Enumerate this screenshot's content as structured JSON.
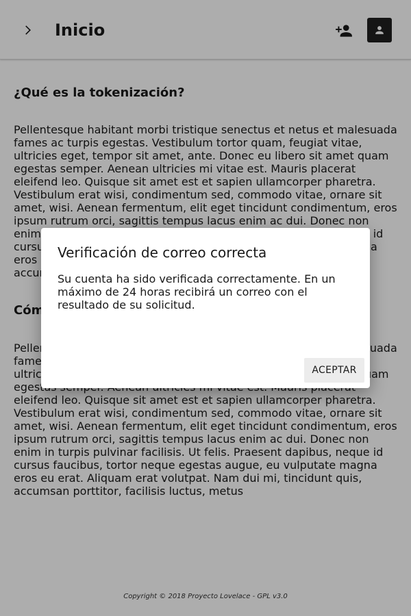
{
  "header": {
    "title": "Inicio",
    "menu_icon": "chevron-right-icon",
    "add_user_icon": "person-add-icon",
    "account_icon": "account-box-icon"
  },
  "content": {
    "sections": [
      {
        "title": "¿Qué es la tokenización?",
        "text": "Pellentesque habitant morbi tristique senectus et netus et malesuada fames ac turpis egestas. Vestibulum tortor quam, feugiat vitae, ultricies eget, tempor sit amet, ante. Donec eu libero sit amet quam egestas semper. Aenean ultricies mi vitae est. Mauris placerat eleifend leo. Quisque sit amet est et sapien ullamcorper pharetra. Vestibulum erat wisi, condimentum sed, commodo vitae, ornare sit amet, wisi. Aenean fermentum, elit eget tincidunt condimentum, eros ipsum rutrum orci, sagittis tempus lacus enim ac dui. Donec non enim in turpis pulvinar facilisis. Ut felis. Praesent dapibus, neque id cursus faucibus, tortor neque egestas augue, eu vulputate magna eros eu erat. Aliquam erat volutpat. Nam dui mi, tincidunt quis, accumsan porttitor, facilisis luctus, metus"
      },
      {
        "title": "Cóm",
        "text": "Pellentesque habitant morbi tristique senectus et netus et malesuada fames ac turpis egestas. Vestibulum tortor quam, feugiat vitae, ultricies eget, tempor sit amet, ante. Donec eu libero sit amet quam egestas semper. Aenean ultricies mi vitae est. Mauris placerat eleifend leo. Quisque sit amet est et sapien ullamcorper pharetra. Vestibulum erat wisi, condimentum sed, commodo vitae, ornare sit amet, wisi. Aenean fermentum, elit eget tincidunt condimentum, eros ipsum rutrum orci, sagittis tempus lacus enim ac dui. Donec non enim in turpis pulvinar facilisis. Ut felis. Praesent dapibus, neque id cursus faucibus, tortor neque egestas augue, eu vulputate magna eros eu erat. Aliquam erat volutpat. Nam dui mi, tincidunt quis, accumsan porttitor, facilisis luctus, metus"
      }
    ]
  },
  "footer": {
    "copyright": "Copyright © 2018 Proyecto Lovelace - GPL v3.0"
  },
  "dialog": {
    "title": "Verificación de correo correcta",
    "body": "Su cuenta ha sido verificada correctamente. En un máximo de 24 horas recibirá un correo con el resultado de su solicitud.",
    "accept_label": "ACEPTAR"
  },
  "colors": {
    "overlay": "#000000",
    "account_button_bg": "#1f1f1f",
    "accept_button_bg": "#ececec"
  }
}
